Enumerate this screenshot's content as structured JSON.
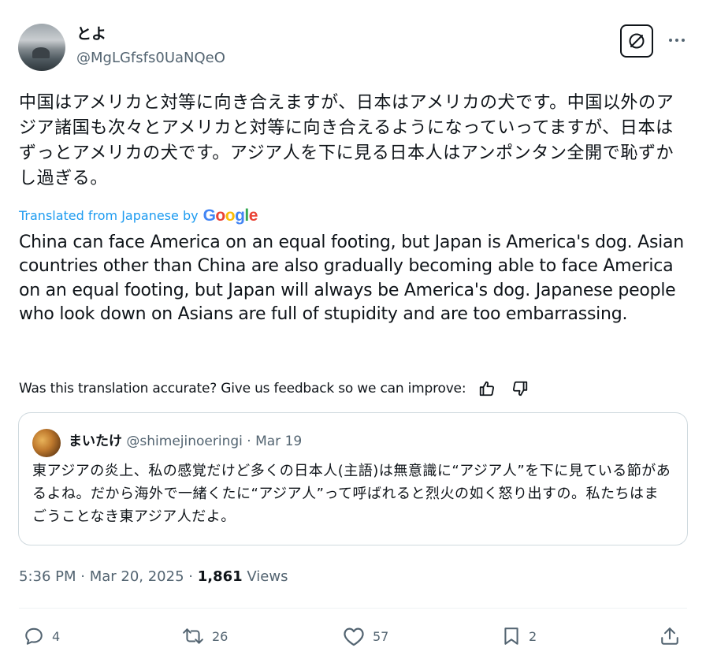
{
  "post": {
    "author_name": "とよ",
    "author_handle": "@MgLGfsfs0UaNQeO",
    "text_original": "中国はアメリカと対等に向き合えますが、日本はアメリカの犬です。中国以外のアジア諸国も次々とアメリカと対等に向き合えるようになっていってますが、日本はずっとアメリカの犬です。アジア人を下に見る日本人はアンポンタン全開で恥ずかし過ぎる。",
    "translated_from": "Translated from Japanese by",
    "translator_logo": "Google",
    "text_translated": "China can face America on an equal footing, but Japan is America's dog. Asian countries other than China are also gradually becoming able to face America on an equal footing, but Japan will always be America's dog. Japanese people who look down on Asians are full of stupidity and are too embarrassing.",
    "feedback_prompt": "Was this translation accurate? Give us feedback so we can improve:",
    "timestamp": "5:36 PM · Mar 20, 2025 · ",
    "views_count": "1,861",
    "views_label": " Views"
  },
  "quoted": {
    "author_name": "まいたけ",
    "author_handle": "@shimejinoeringi",
    "date": " · Mar 19",
    "text": "東アジアの炎上、私の感覚だけど多くの日本人(主語)は無意識に“アジア人”を下に見ている節があるよね。だから海外で一緒くたに“アジア人”って呼ばれると烈火の如く怒り出すの。私たちはまごうことなき東アジア人だよ。"
  },
  "actions": {
    "replies": "4",
    "reposts": "26",
    "likes": "57",
    "bookmarks": "2"
  },
  "icons": [
    "grok-icon",
    "more-icon",
    "thumbs-up-icon",
    "thumbs-down-icon",
    "reply-icon",
    "repost-icon",
    "like-icon",
    "bookmark-icon",
    "share-icon"
  ],
  "colors": {
    "link_blue": "#1d9bf0",
    "secondary_text": "#536471",
    "border": "#cfd9de"
  }
}
